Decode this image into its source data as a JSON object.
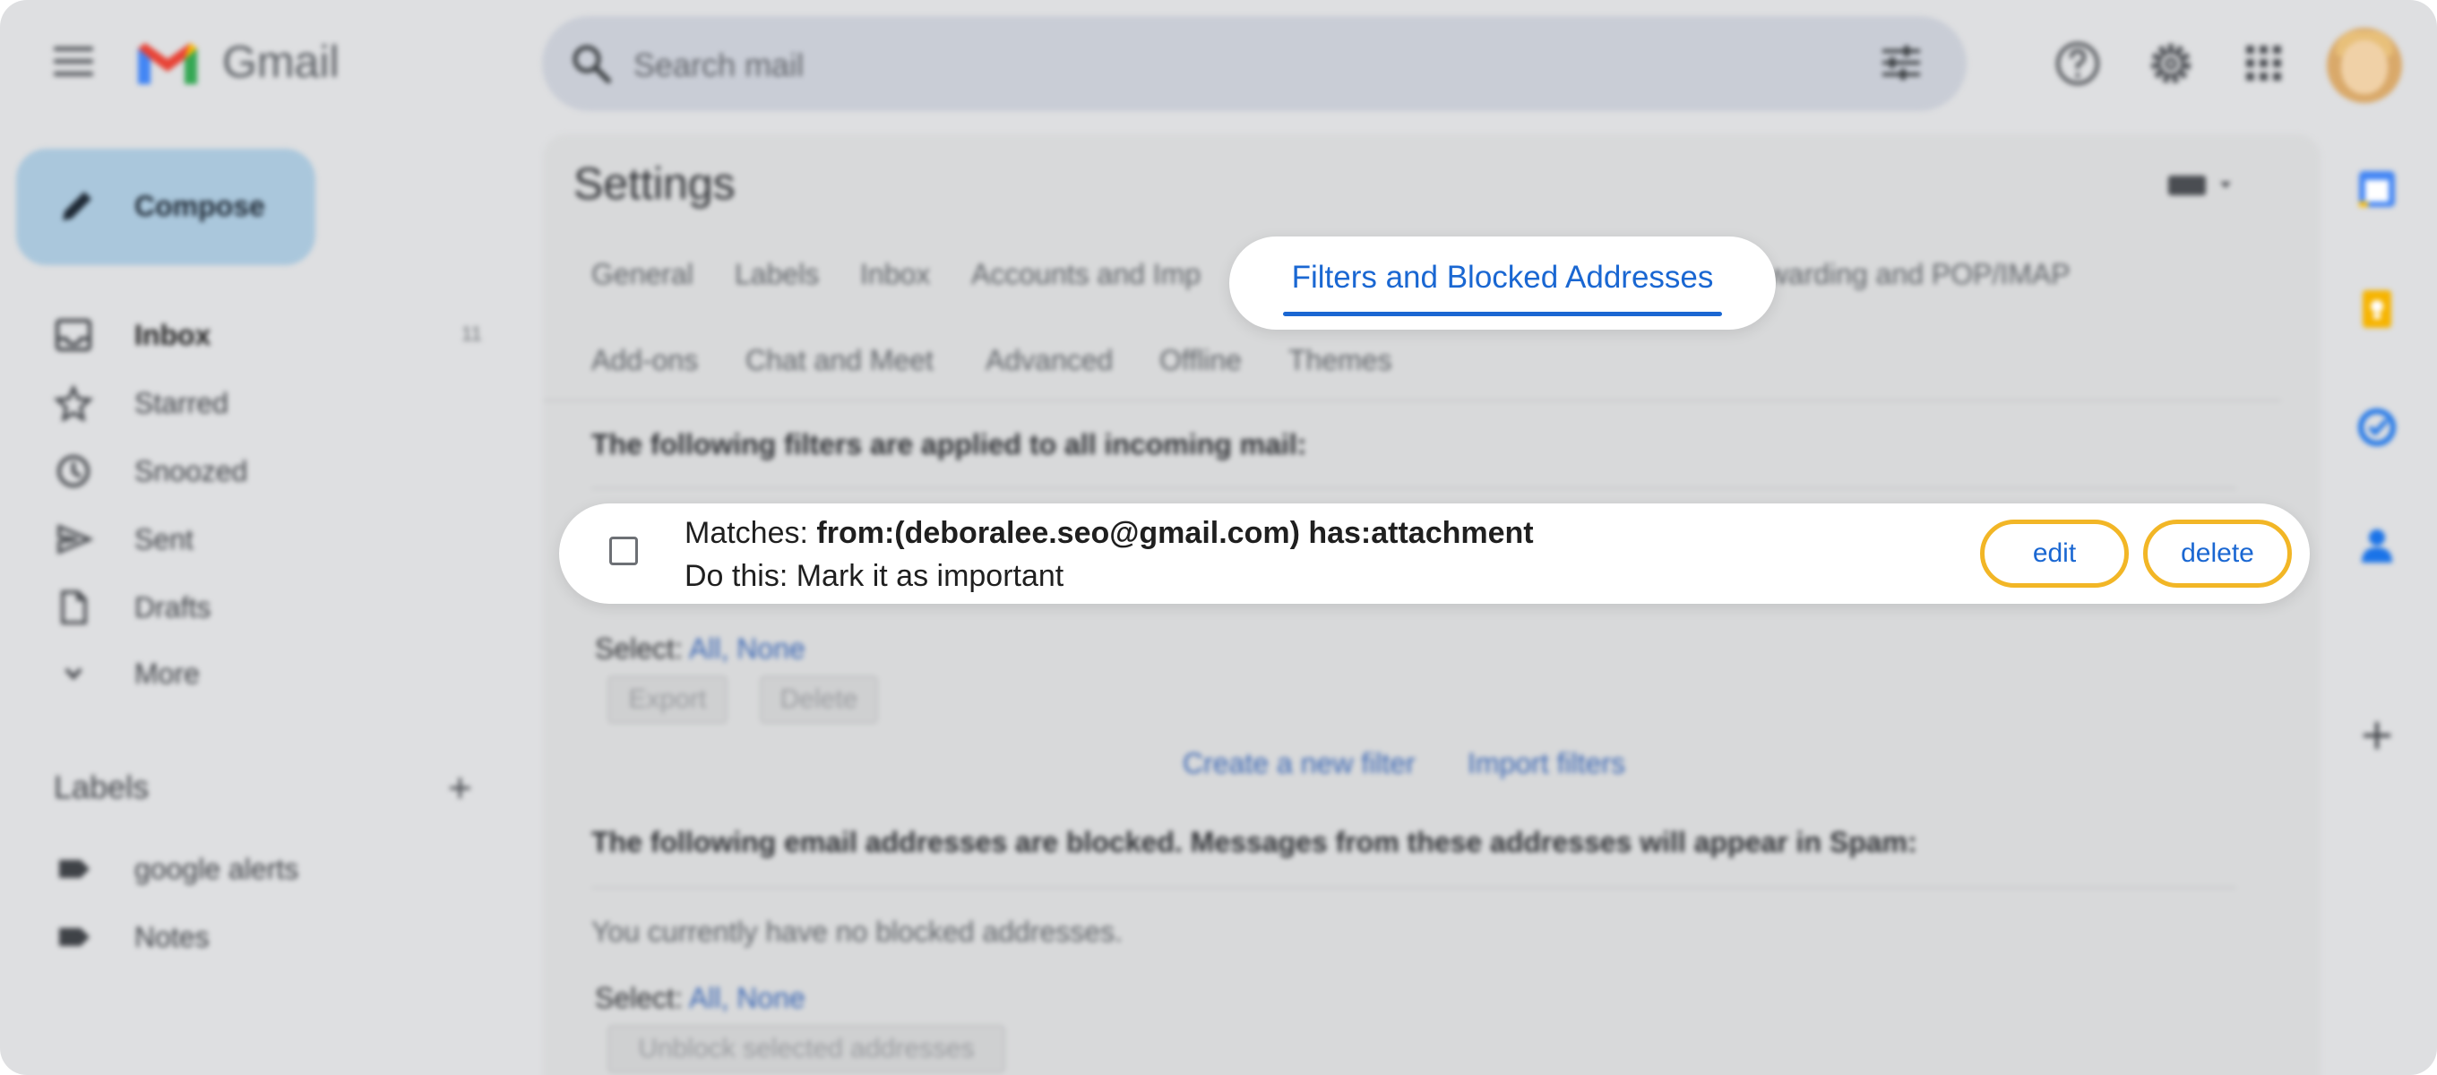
{
  "app": {
    "name": "Gmail"
  },
  "search": {
    "placeholder": "Search mail"
  },
  "compose": {
    "label": "Compose"
  },
  "nav": [
    {
      "label": "Inbox",
      "count": "11",
      "icon": "inbox-icon",
      "active": true
    },
    {
      "label": "Starred",
      "icon": "star-icon"
    },
    {
      "label": "Snoozed",
      "icon": "clock-icon"
    },
    {
      "label": "Sent",
      "icon": "send-icon"
    },
    {
      "label": "Drafts",
      "icon": "draft-icon"
    },
    {
      "label": "More",
      "icon": "chevron-down-icon"
    }
  ],
  "labels": {
    "heading": "Labels",
    "items": [
      {
        "label": "google alerts",
        "icon": "label-icon"
      },
      {
        "label": "Notes",
        "icon": "label-icon"
      }
    ]
  },
  "settings": {
    "title": "Settings",
    "tabs_row1": [
      "General",
      "Labels",
      "Inbox",
      "Accounts and Imp",
      "Filters and Blocked Addresses",
      "rwarding and POP/IMAP"
    ],
    "tabs_row2": [
      "Add-ons",
      "Chat and Meet",
      "Advanced",
      "Offline",
      "Themes"
    ],
    "active_tab": "Filters and Blocked Addresses",
    "filters_heading": "The following filters are applied to all incoming mail:",
    "filter": {
      "matches_label": "Matches:",
      "criteria": "from:(deboralee.seo@gmail.com) has:attachment",
      "action": "Do this: Mark it as important",
      "edit_label": "edit",
      "delete_label": "delete"
    },
    "select_label": "Select:",
    "select_all": "All",
    "select_sep": ",",
    "select_none": "None",
    "export_label": "Export",
    "delete_label": "Delete",
    "create_filter": "Create a new filter",
    "import_filters": "Import filters",
    "blocked_heading": "The following email addresses are blocked. Messages from these addresses will appear in Spam:",
    "no_blocked": "You currently have no blocked addresses.",
    "unblock_label": "Unblock selected addresses"
  },
  "colors": {
    "accent": "#1a67d2",
    "highlight_ring": "#f2b626",
    "link": "#3b67b4"
  }
}
